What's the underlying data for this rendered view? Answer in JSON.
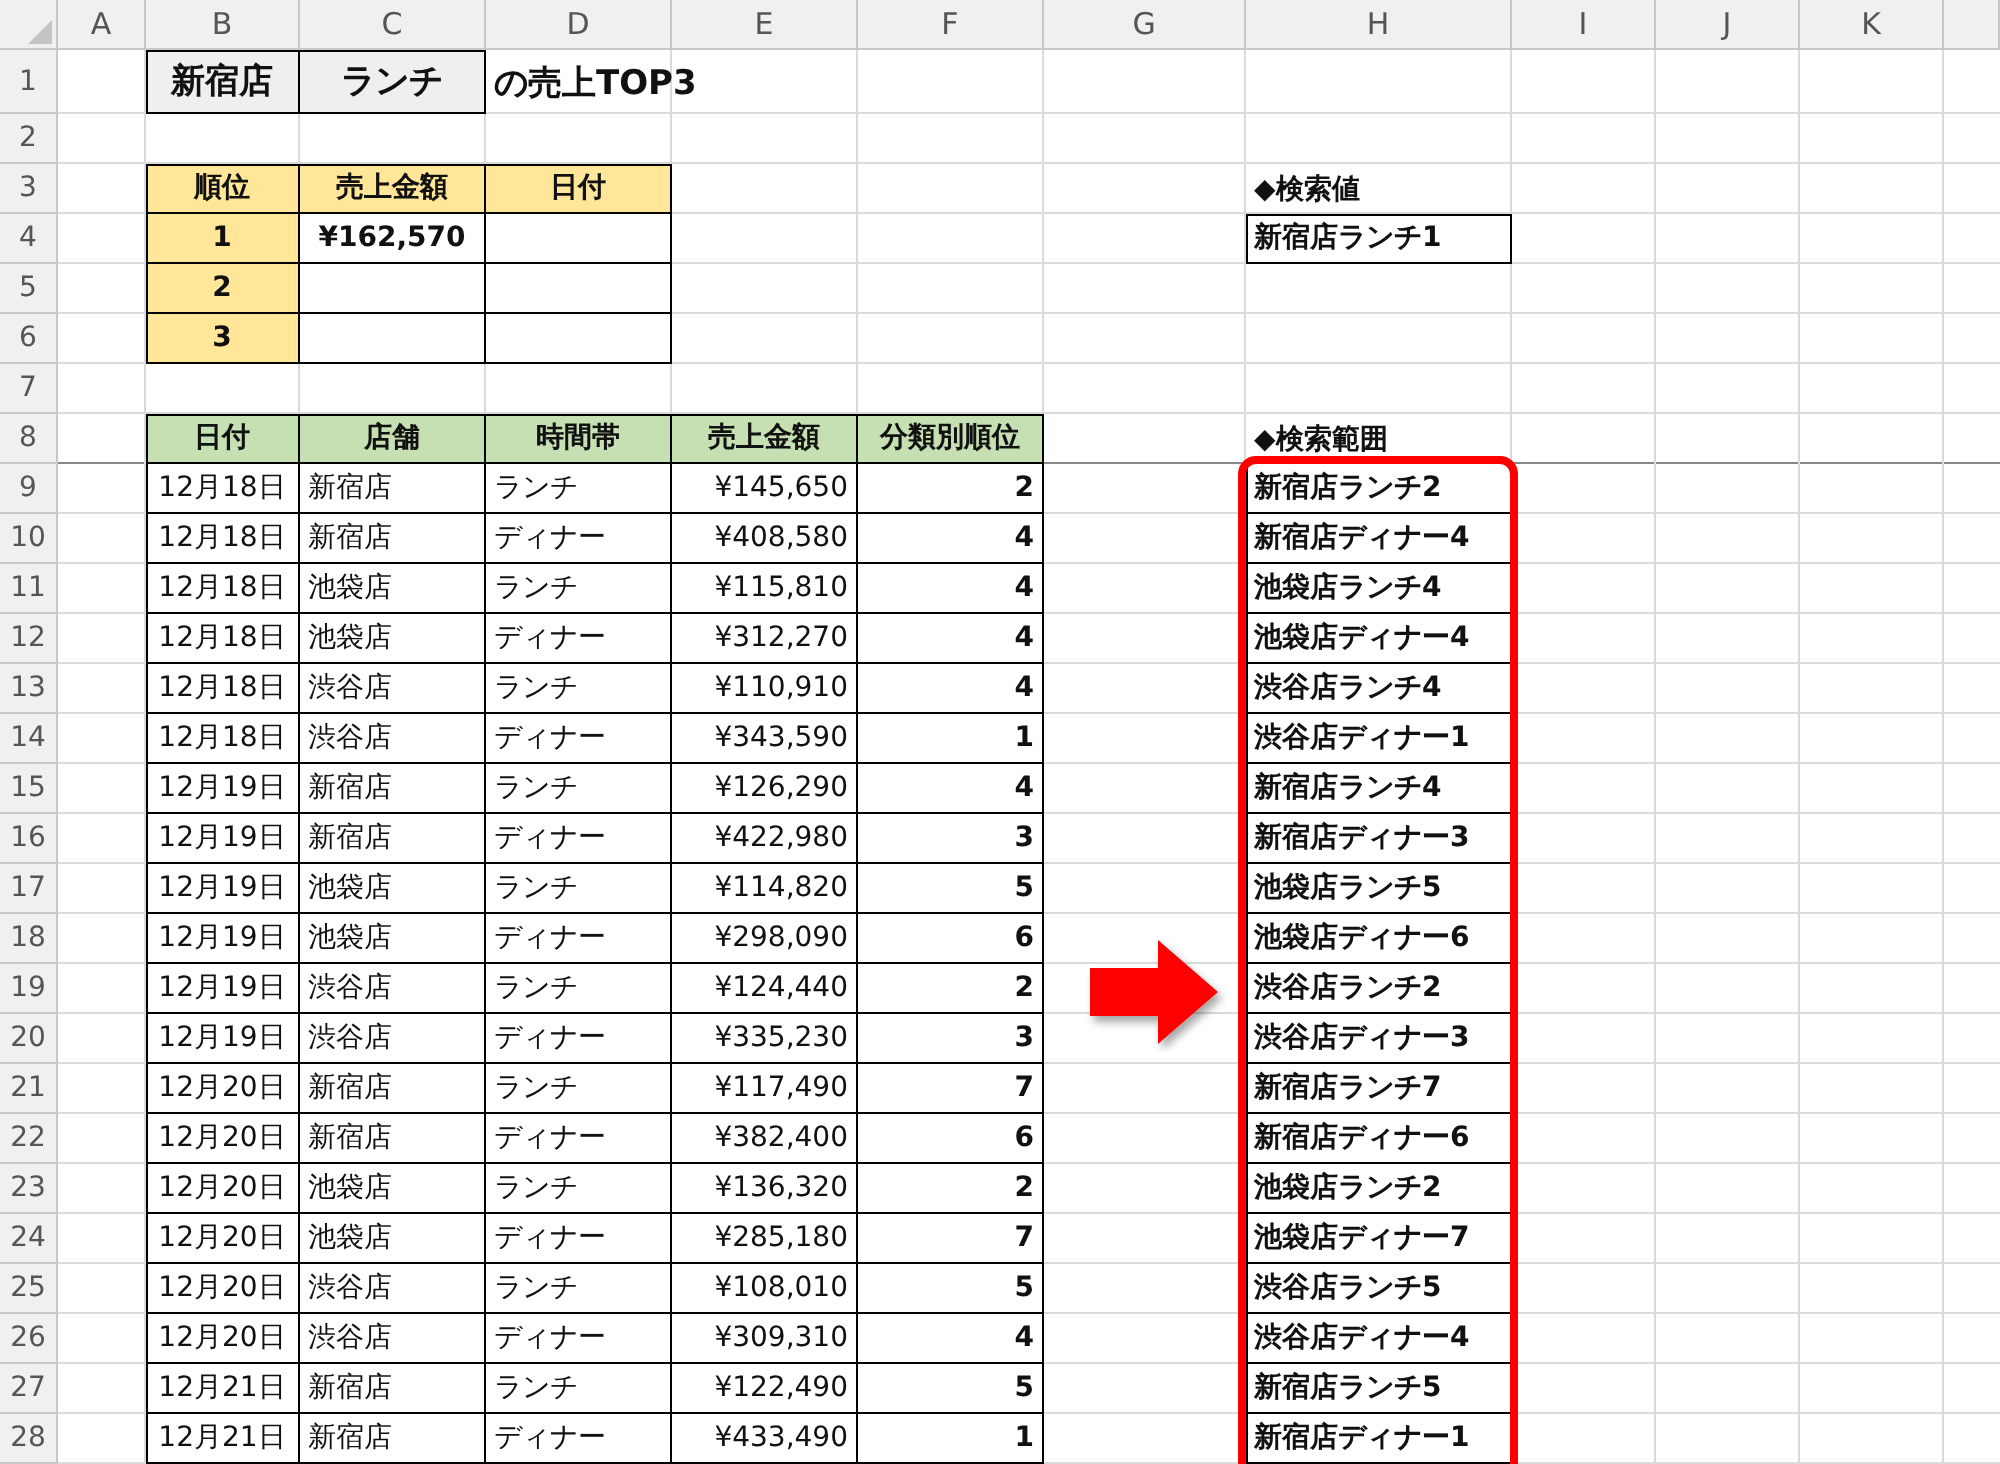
{
  "column_headers": [
    "A",
    "B",
    "C",
    "D",
    "E",
    "F",
    "G",
    "H",
    "I",
    "J",
    "K"
  ],
  "row_headers": [
    "1",
    "2",
    "3",
    "4",
    "5",
    "6",
    "7",
    "8",
    "9",
    "10",
    "11",
    "12",
    "13",
    "14",
    "15",
    "16",
    "17",
    "18",
    "19",
    "20",
    "21",
    "22",
    "23",
    "24",
    "25",
    "26",
    "27",
    "28"
  ],
  "title": {
    "store": "新宿店",
    "time_slot": "ランチ",
    "suffix": "の売上TOP3"
  },
  "top3_table": {
    "columns": [
      "順位",
      "売上金額",
      "日付"
    ],
    "rows": [
      {
        "rank": "1",
        "amount": "¥162,570"
      },
      {
        "rank": "2"
      },
      {
        "rank": "3"
      }
    ]
  },
  "search_value": {
    "label": "◆検索値",
    "value": "新宿店ランチ1"
  },
  "sales_table": {
    "columns": [
      "日付",
      "店舗",
      "時間帯",
      "売上金額",
      "分類別順位"
    ],
    "rows": [
      {
        "date": "12月18日",
        "store": "新宿店",
        "time_slot": "ランチ",
        "amount": "¥145,650",
        "rank": "2"
      },
      {
        "date": "12月18日",
        "store": "新宿店",
        "time_slot": "ディナー",
        "amount": "¥408,580",
        "rank": "4"
      },
      {
        "date": "12月18日",
        "store": "池袋店",
        "time_slot": "ランチ",
        "amount": "¥115,810",
        "rank": "4"
      },
      {
        "date": "12月18日",
        "store": "池袋店",
        "time_slot": "ディナー",
        "amount": "¥312,270",
        "rank": "4"
      },
      {
        "date": "12月18日",
        "store": "渋谷店",
        "time_slot": "ランチ",
        "amount": "¥110,910",
        "rank": "4"
      },
      {
        "date": "12月18日",
        "store": "渋谷店",
        "time_slot": "ディナー",
        "amount": "¥343,590",
        "rank": "1"
      },
      {
        "date": "12月19日",
        "store": "新宿店",
        "time_slot": "ランチ",
        "amount": "¥126,290",
        "rank": "4"
      },
      {
        "date": "12月19日",
        "store": "新宿店",
        "time_slot": "ディナー",
        "amount": "¥422,980",
        "rank": "3"
      },
      {
        "date": "12月19日",
        "store": "池袋店",
        "time_slot": "ランチ",
        "amount": "¥114,820",
        "rank": "5"
      },
      {
        "date": "12月19日",
        "store": "池袋店",
        "time_slot": "ディナー",
        "amount": "¥298,090",
        "rank": "6"
      },
      {
        "date": "12月19日",
        "store": "渋谷店",
        "time_slot": "ランチ",
        "amount": "¥124,440",
        "rank": "2"
      },
      {
        "date": "12月19日",
        "store": "渋谷店",
        "time_slot": "ディナー",
        "amount": "¥335,230",
        "rank": "3"
      },
      {
        "date": "12月20日",
        "store": "新宿店",
        "time_slot": "ランチ",
        "amount": "¥117,490",
        "rank": "7"
      },
      {
        "date": "12月20日",
        "store": "新宿店",
        "time_slot": "ディナー",
        "amount": "¥382,400",
        "rank": "6"
      },
      {
        "date": "12月20日",
        "store": "池袋店",
        "time_slot": "ランチ",
        "amount": "¥136,320",
        "rank": "2"
      },
      {
        "date": "12月20日",
        "store": "池袋店",
        "time_slot": "ディナー",
        "amount": "¥285,180",
        "rank": "7"
      },
      {
        "date": "12月20日",
        "store": "渋谷店",
        "time_slot": "ランチ",
        "amount": "¥108,010",
        "rank": "5"
      },
      {
        "date": "12月20日",
        "store": "渋谷店",
        "time_slot": "ディナー",
        "amount": "¥309,310",
        "rank": "4"
      },
      {
        "date": "12月21日",
        "store": "新宿店",
        "time_slot": "ランチ",
        "amount": "¥122,490",
        "rank": "5"
      },
      {
        "date": "12月21日",
        "store": "新宿店",
        "time_slot": "ディナー",
        "amount": "¥433,490",
        "rank": "1"
      }
    ]
  },
  "search_range": {
    "label": "◆検索範囲",
    "highlighted": true,
    "values": [
      "新宿店ランチ2",
      "新宿店ディナー4",
      "池袋店ランチ4",
      "池袋店ディナー4",
      "渋谷店ランチ4",
      "渋谷店ディナー1",
      "新宿店ランチ4",
      "新宿店ディナー3",
      "池袋店ランチ5",
      "池袋店ディナー6",
      "渋谷店ランチ2",
      "渋谷店ディナー3",
      "新宿店ランチ7",
      "新宿店ディナー6",
      "池袋店ランチ2",
      "池袋店ディナー7",
      "渋谷店ランチ5",
      "渋谷店ディナー4",
      "新宿店ランチ5",
      "新宿店ディナー1"
    ]
  }
}
